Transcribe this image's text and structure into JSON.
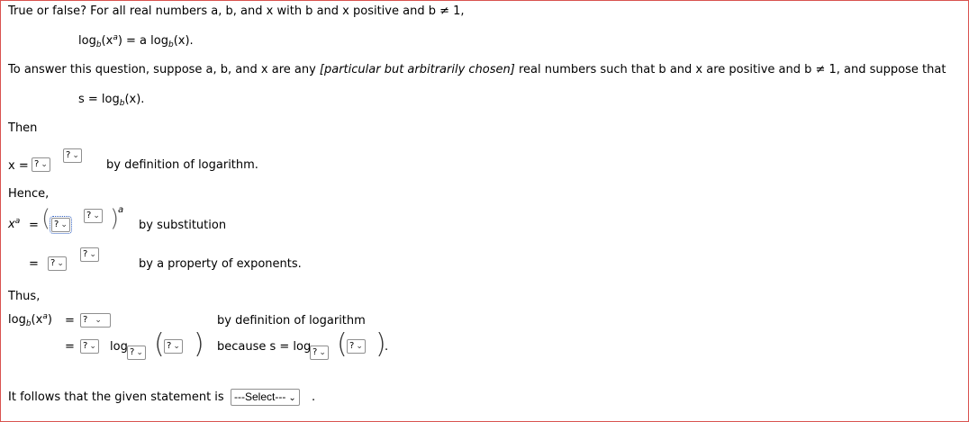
{
  "question": {
    "intro": "True or false? For all real numbers a, b, and x with b and x positive and b ≠ 1,",
    "statement_lhs_log": "log",
    "statement_base": "b",
    "statement_arg": "(x",
    "statement_exp": "a",
    "statement_rest": ") = a log",
    "statement_base2": "b",
    "statement_end": "(x).",
    "setup_a": "To answer this question, suppose a, b, and x are any ",
    "setup_b": "[particular but arbitrarily chosen]",
    "setup_c": " real numbers such that b and x are positive and b ≠ 1, and suppose that",
    "s_def_a": "s = log",
    "s_def_base": "b",
    "s_def_b": "(x)."
  },
  "proof": {
    "then": "Then",
    "x_eq": "x =",
    "by_def_log": "by definition of logarithm.",
    "hence": "Hence,",
    "x_a_base": "x",
    "x_a_exp": "a",
    "eq": "=",
    "exp_a": "a",
    "by_subst": "by substitution",
    "by_prop_exp": "by a property of exponents.",
    "thus": "Thus,",
    "log_lhs": "log",
    "log_base": "b",
    "log_arg": "(x",
    "log_exp": "a",
    "log_close": ")",
    "by_def_log2": "by definition of logarithm",
    "log_word": "log",
    "because": "because s = log",
    "period": ".",
    "conclusion": "It follows that the given statement is",
    "conclusion_end": "."
  },
  "dropdowns": {
    "placeholder": "?",
    "chevron": "⌄",
    "final_select": "---Select---"
  }
}
